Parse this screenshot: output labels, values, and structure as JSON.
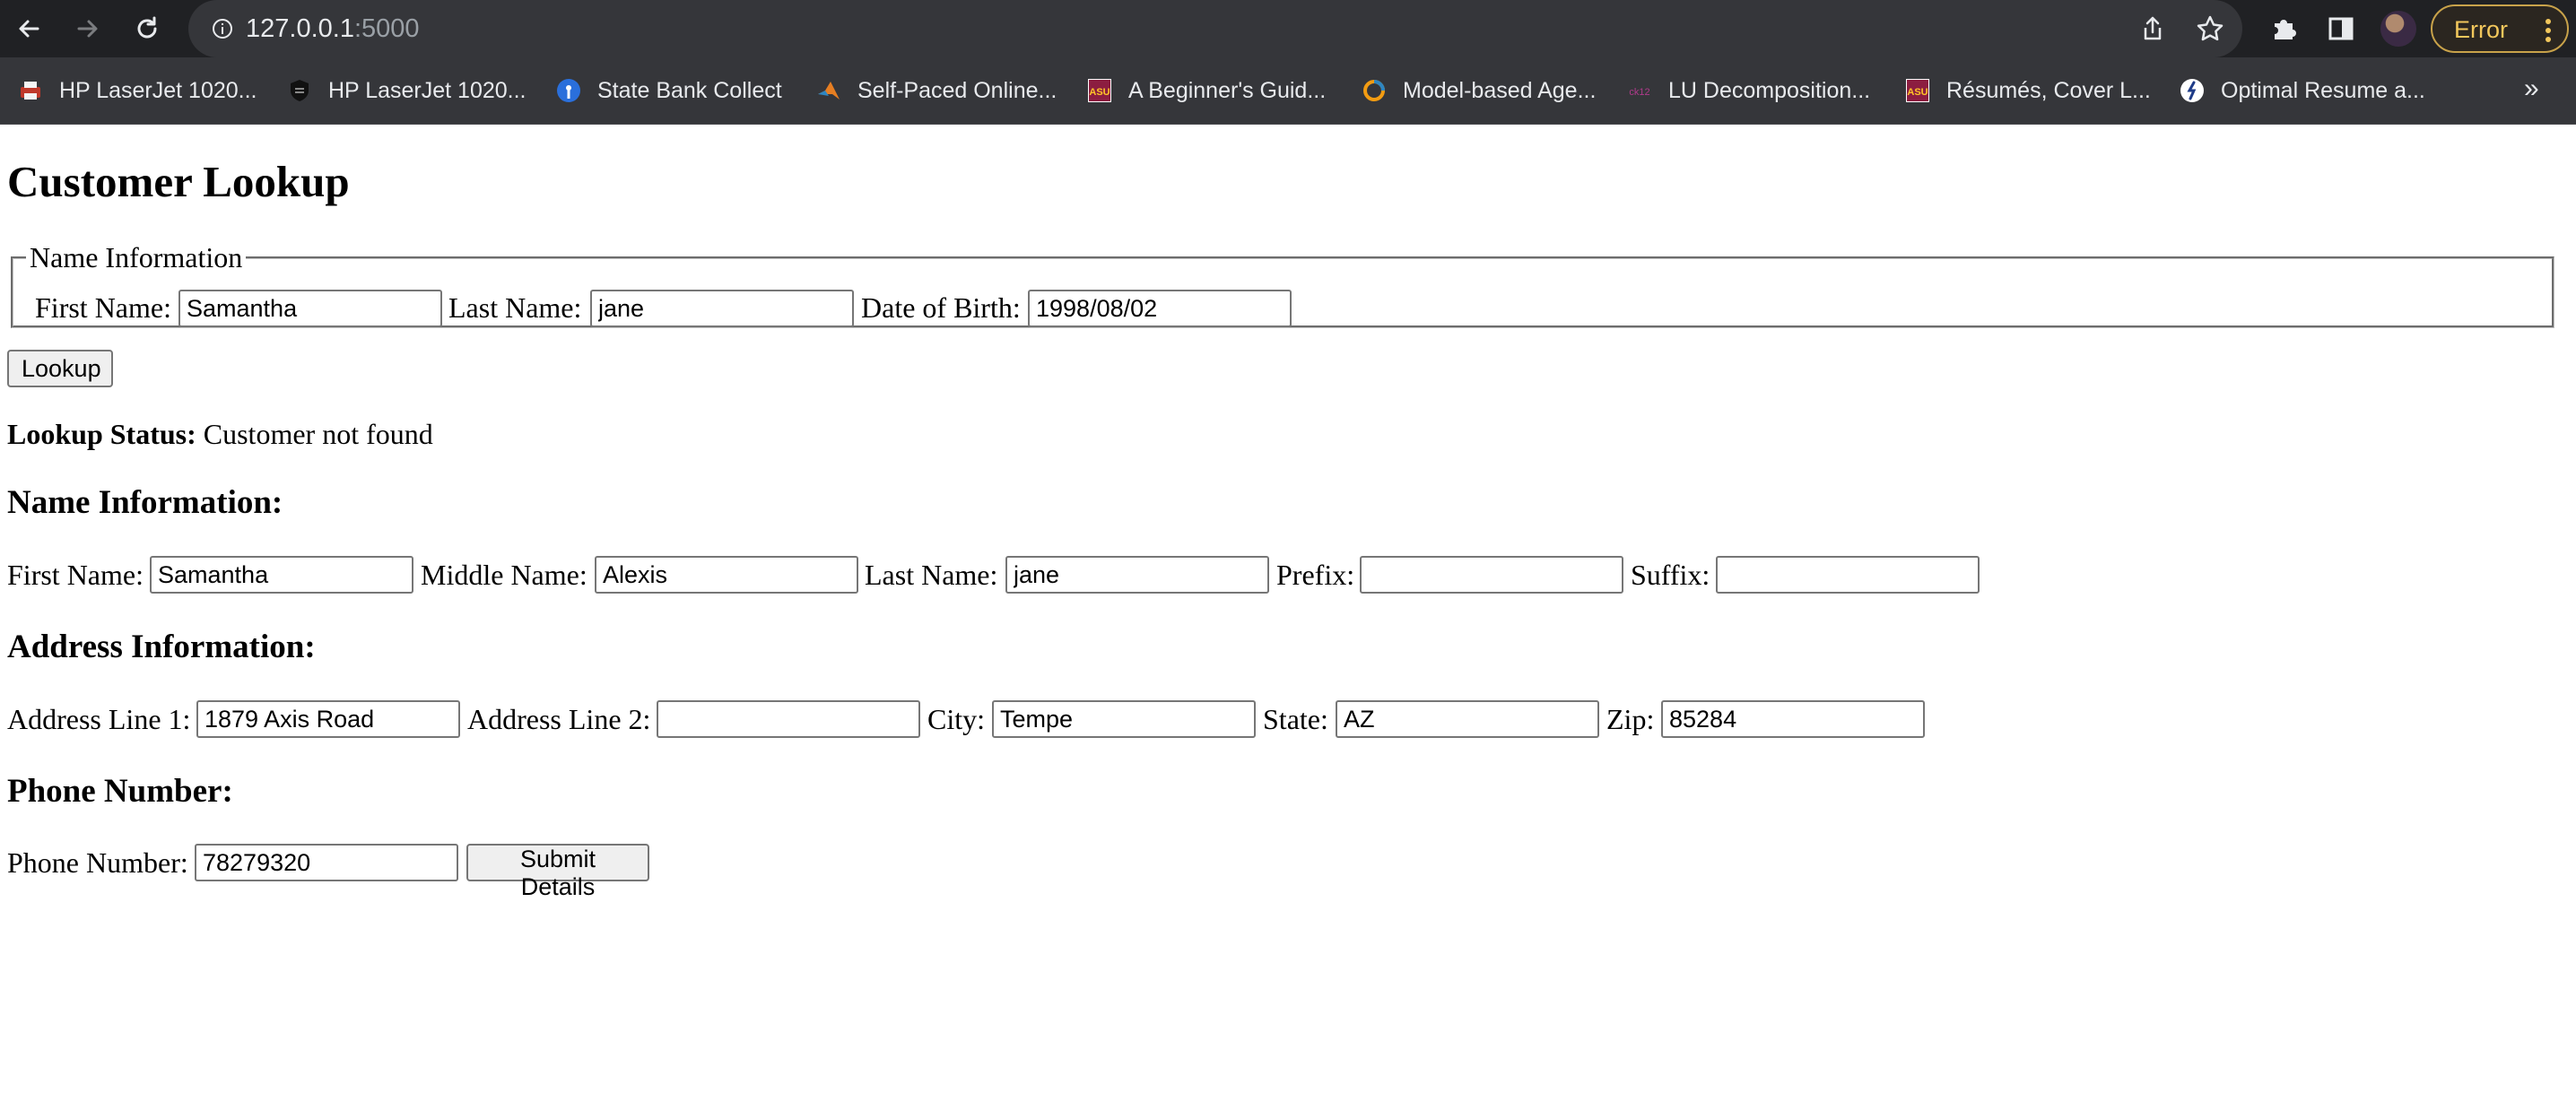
{
  "browser": {
    "url_host": "127.0.0.1",
    "url_port": ":5000",
    "error_label": "Error",
    "bookmarks": [
      {
        "label": "HP LaserJet 1020...",
        "icon": "printer-icon",
        "color": "#c0392b"
      },
      {
        "label": "HP LaserJet 1020...",
        "icon": "shield-icon",
        "color": "#111111"
      },
      {
        "label": "State Bank Collect",
        "icon": "sbi-icon",
        "color": "#2a6fdb"
      },
      {
        "label": "Self-Paced Online...",
        "icon": "matlab-icon",
        "color": "#e67e22"
      },
      {
        "label": "A Beginner's Guid...",
        "icon": "asu-icon",
        "color": "#8c1d40"
      },
      {
        "label": "Model-based Age...",
        "icon": "ring-icon",
        "color": "#f39c12"
      },
      {
        "label": "LU Decomposition...",
        "icon": "ck12-icon",
        "color": "#b03a8c"
      },
      {
        "label": "Résumés, Cover L...",
        "icon": "asu-icon",
        "color": "#8c1d40"
      },
      {
        "label": "Optimal Resume a...",
        "icon": "runner-icon",
        "color": "#1f3c88"
      }
    ],
    "more_bookmarks": "»"
  },
  "page": {
    "title": "Customer Lookup",
    "lookup_fieldset": {
      "legend": "Name Information",
      "first_name_label": "First Name:",
      "first_name_value": "Samantha",
      "last_name_label": "Last Name:",
      "last_name_value": "jane",
      "dob_label": "Date of Birth:",
      "dob_value": "1998/08/02"
    },
    "lookup_button": "Lookup",
    "status_label": "Lookup Status:",
    "status_value": " Customer not found",
    "name_section": {
      "heading": "Name Information:",
      "first_name_label": "First Name:",
      "first_name_value": "Samantha",
      "middle_name_label": "Middle Name:",
      "middle_name_value": "Alexis",
      "last_name_label": "Last Name:",
      "last_name_value": "jane",
      "prefix_label": "Prefix:",
      "prefix_value": "",
      "suffix_label": "Suffix:",
      "suffix_value": ""
    },
    "address_section": {
      "heading": "Address Information:",
      "line1_label": "Address Line 1:",
      "line1_value": "1879 Axis Road",
      "line2_label": "Address Line 2:",
      "line2_value": "",
      "city_label": "City:",
      "city_value": "Tempe",
      "state_label": "State:",
      "state_value": "AZ",
      "zip_label": "Zip:",
      "zip_value": "85284"
    },
    "phone_section": {
      "heading": "Phone Number:",
      "phone_label": "Phone Number:",
      "phone_value": "78279320",
      "submit_button": "Submit Details"
    }
  }
}
